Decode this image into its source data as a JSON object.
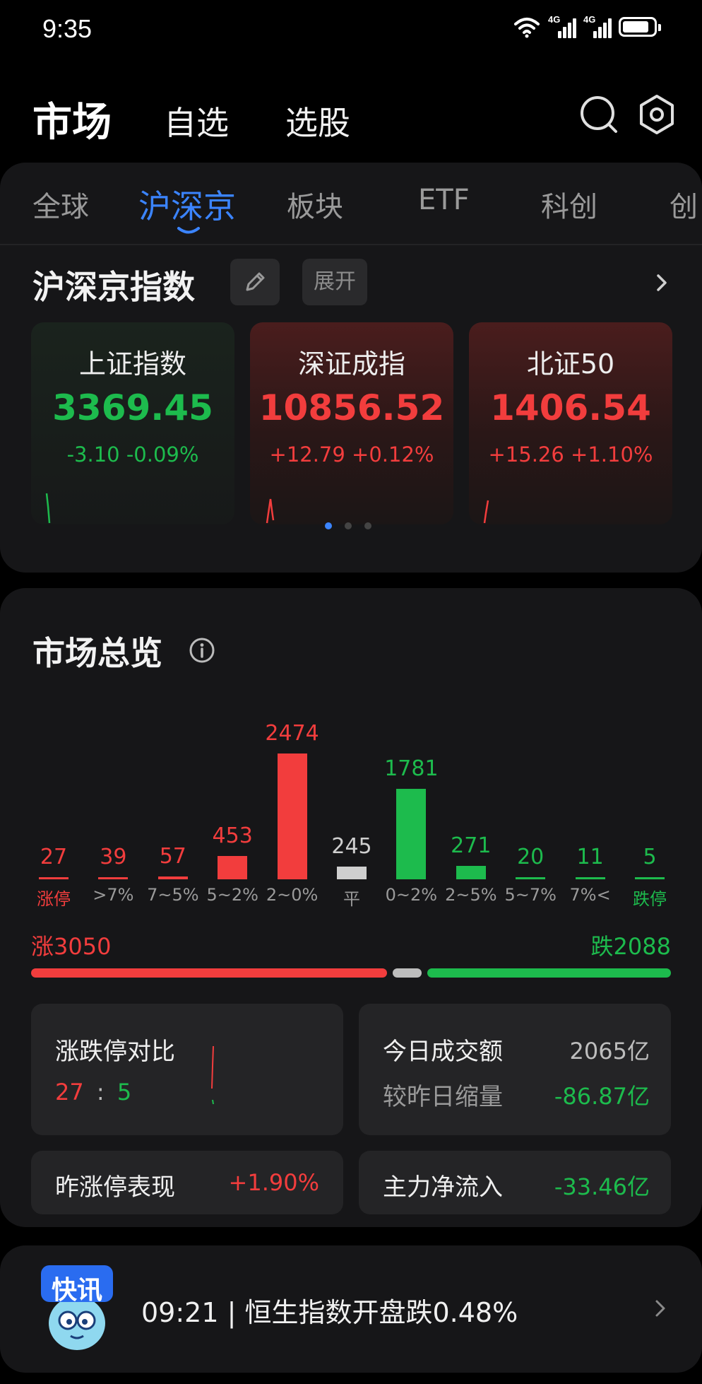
{
  "status_bar": {
    "time": "9:35",
    "icons": [
      "wifi-icon",
      "signal-4g-icon",
      "signal-4g-icon",
      "battery-icon"
    ],
    "signal_label_1": "4G",
    "signal_label_2": "4G",
    "battery_level": 0.85
  },
  "header": {
    "title": "市场",
    "tabs": [
      "自选",
      "选股"
    ],
    "icons": [
      "search-icon",
      "settings-icon"
    ]
  },
  "market_tabs": {
    "items": [
      "全球",
      "沪深京",
      "板块",
      "ETF",
      "科创",
      "创"
    ],
    "active": "沪深京"
  },
  "indices_section": {
    "title": "沪深京指数",
    "edit_icon": "pencil-icon",
    "expand_label": "展开",
    "more_icon": "chevron-right-icon",
    "cards": [
      {
        "name": "上证指数",
        "value": "3369.45",
        "change": "-3.10  -0.09%",
        "trend": "down",
        "color": "#1dbb4d"
      },
      {
        "name": "深证成指",
        "value": "10856.52",
        "change": "+12.79  +0.12%",
        "trend": "up",
        "color": "#f23d3d"
      },
      {
        "name": "北证50",
        "value": "1406.54",
        "change": "+15.26  +1.10%",
        "trend": "up",
        "color": "#f23d3d"
      }
    ],
    "page_indicator": {
      "count": 3,
      "active": 0
    }
  },
  "market_overview": {
    "title": "市场总览",
    "info_icon": "info-icon",
    "chart_data": {
      "type": "bar",
      "categories": [
        "涨停",
        ">7%",
        "7~5%",
        "5~2%",
        "2~0%",
        "平",
        "0~2%",
        "2~5%",
        "5~7%",
        "7%<",
        "跌停"
      ],
      "values": [
        27,
        39,
        57,
        453,
        2474,
        245,
        1781,
        271,
        20,
        11,
        5
      ],
      "value_labels": [
        "27",
        "39",
        "57",
        "453",
        "2474",
        "245",
        "1781",
        "271",
        "20",
        "11",
        "5"
      ],
      "bar_colors": [
        "#f23d3d",
        "#f23d3d",
        "#f23d3d",
        "#f23d3d",
        "#f23d3d",
        "#cfcfcf",
        "#1dbb4d",
        "#1dbb4d",
        "#1dbb4d",
        "#1dbb4d",
        "#1dbb4d"
      ],
      "label_colors": [
        "#f23d3d",
        "#9a9a9a",
        "#9a9a9a",
        "#9a9a9a",
        "#9a9a9a",
        "#9a9a9a",
        "#9a9a9a",
        "#9a9a9a",
        "#9a9a9a",
        "#9a9a9a",
        "#1dbb4d"
      ],
      "title": "",
      "xlabel": "",
      "ylabel": ""
    },
    "rise_label": "涨3050",
    "fall_label": "跌2088",
    "rise_count": 3050,
    "flat_count": 245,
    "fall_count": 2088,
    "colors": {
      "up": "#f23d3d",
      "down": "#1dbb4d",
      "flat": "#bdbdbd"
    }
  },
  "stats": {
    "limit_ratio": {
      "label": "涨跌停对比",
      "up": "27",
      "sep": ":",
      "down": "5"
    },
    "turnover": {
      "label": "今日成交额",
      "value": "2065亿",
      "cmp_label": "较昨日缩量",
      "cmp_value": "-86.87亿"
    },
    "yesterday_limit": {
      "label": "昨涨停表现",
      "value": "+1.90%"
    },
    "main_inflow": {
      "label": "主力净流入",
      "value": "-33.46亿"
    }
  },
  "news": {
    "badge": "快讯",
    "text": "09:21 | 恒生指数开盘跌0.48%",
    "icon": "news-mascot-icon",
    "more_icon": "chevron-right-icon"
  }
}
